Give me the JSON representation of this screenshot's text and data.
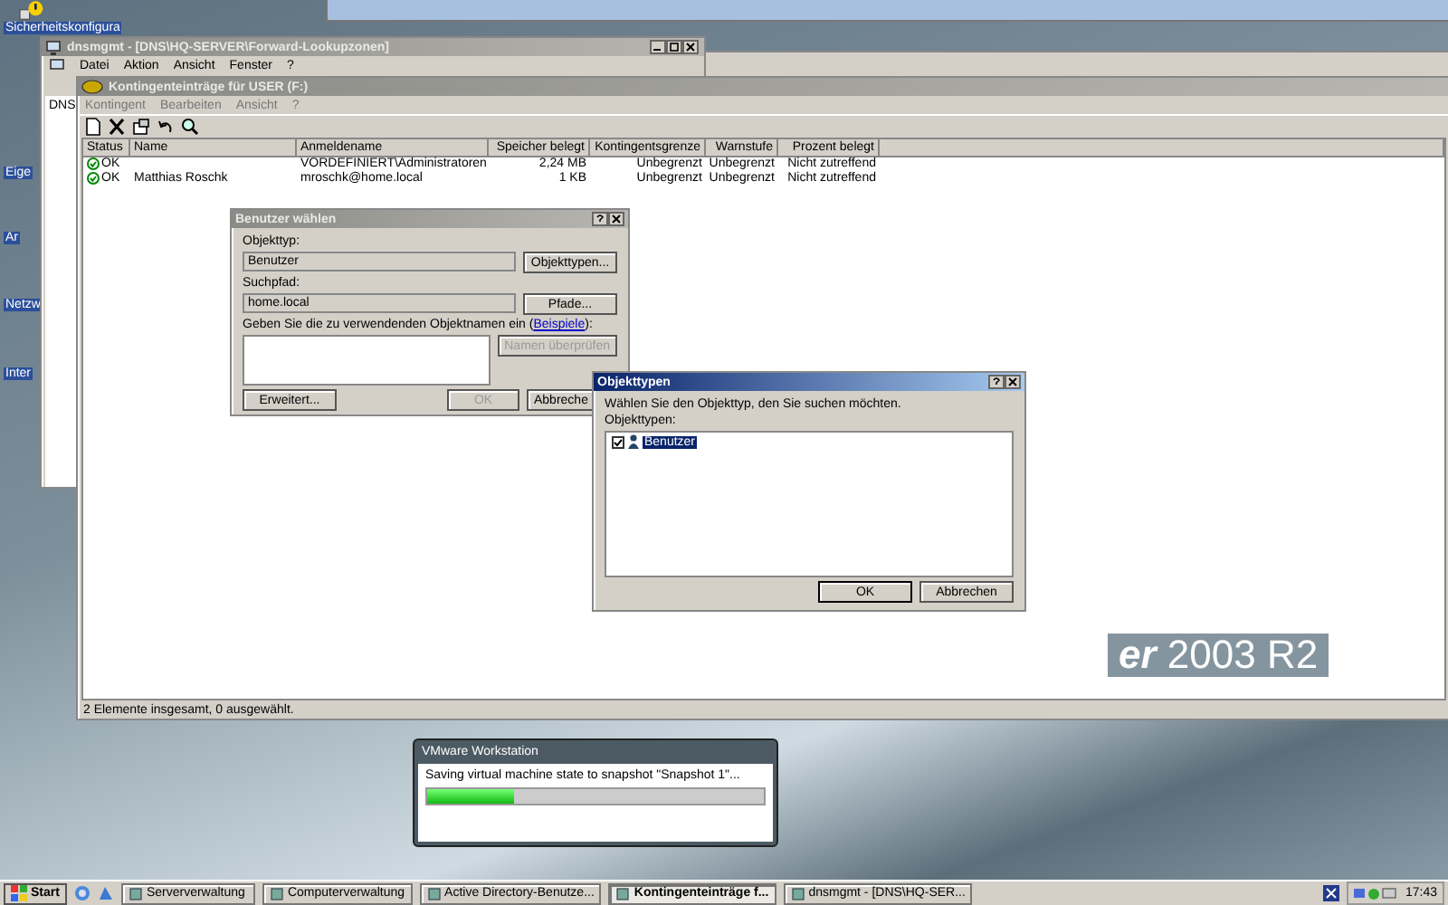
{
  "desktop_icons": [
    {
      "label": "Sicherheitskonfigura"
    },
    {
      "label": "Eige"
    },
    {
      "label": "Ar"
    },
    {
      "label": "Netzw"
    },
    {
      "label": "Inter"
    }
  ],
  "background_logo": {
    "bold": "er",
    "rest": "2003 R2"
  },
  "dns_window": {
    "title": "dnsmgmt - [DNS\\HQ-SERVER\\Forward-Lookupzonen]",
    "menu": [
      "Datei",
      "Aktion",
      "Ansicht",
      "Fenster",
      "?"
    ],
    "tree_root": "DNS"
  },
  "quota_window": {
    "title": "Kontingenteinträge für USER (F:)",
    "menu": [
      "Kontingent",
      "Bearbeiten",
      "Ansicht",
      "?"
    ],
    "columns": [
      "Status",
      "Name",
      "Anmeldename",
      "Speicher belegt",
      "Kontingentsgrenze",
      "Warnstufe",
      "Prozent belegt"
    ],
    "rows": [
      {
        "status": "OK",
        "name": "",
        "login": "VORDEFINIERT\\Administratoren",
        "used": "2,24 MB",
        "limit": "Unbegrenzt",
        "warning": "Unbegrenzt",
        "percent": "Nicht zutreffend"
      },
      {
        "status": "OK",
        "name": "Matthias Roschk",
        "login": "mroschk@home.local",
        "used": "1 KB",
        "limit": "Unbegrenzt",
        "warning": "Unbegrenzt",
        "percent": "Nicht zutreffend"
      }
    ],
    "status_bar": "2 Elemente insgesamt, 0 ausgewählt."
  },
  "select_user_dialog": {
    "title": "Benutzer wählen",
    "object_type_label": "Objekttyp:",
    "object_type": "Benutzer",
    "object_types_button": "Objekttypen...",
    "path_label": "Suchpfad:",
    "path": "home.local",
    "paths_button": "Pfade...",
    "names_label_before": "Geben Sie die zu verwendenden Objektnamen ein (",
    "examples_link": "Beispiele",
    "names_label_after": "):",
    "check_names_button": {
      "label": "Namen überprüfen",
      "disabled": true
    },
    "advanced_button": "Erweitert...",
    "ok_button": {
      "label": "OK",
      "disabled": true
    },
    "cancel_button": "Abbreche"
  },
  "object_types_dialog": {
    "title": "Objekttypen",
    "prompt": "Wählen Sie den Objekttyp, den Sie suchen möchten.",
    "list_label": "Objekttypen:",
    "items": [
      {
        "label": "Benutzer",
        "checked": true,
        "selected": true
      }
    ],
    "ok_button": "OK",
    "cancel_button": "Abbrechen"
  },
  "progress_dialog": {
    "title": "VMware Workstation",
    "message": "Saving virtual machine state to snapshot \"Snapshot 1\"...",
    "level": 0.26
  },
  "taskbar": {
    "start": "Start",
    "buttons": [
      {
        "label": "Serververwaltung",
        "selected": false
      },
      {
        "label": "Computerverwaltung",
        "selected": false
      },
      {
        "label": "Active Directory-Benutze...",
        "selected": false
      },
      {
        "label": "Kontingenteinträge f...",
        "selected": true
      },
      {
        "label": "dnsmgmt - [DNS\\HQ-SER...",
        "selected": false
      }
    ],
    "clock": "17:43"
  }
}
